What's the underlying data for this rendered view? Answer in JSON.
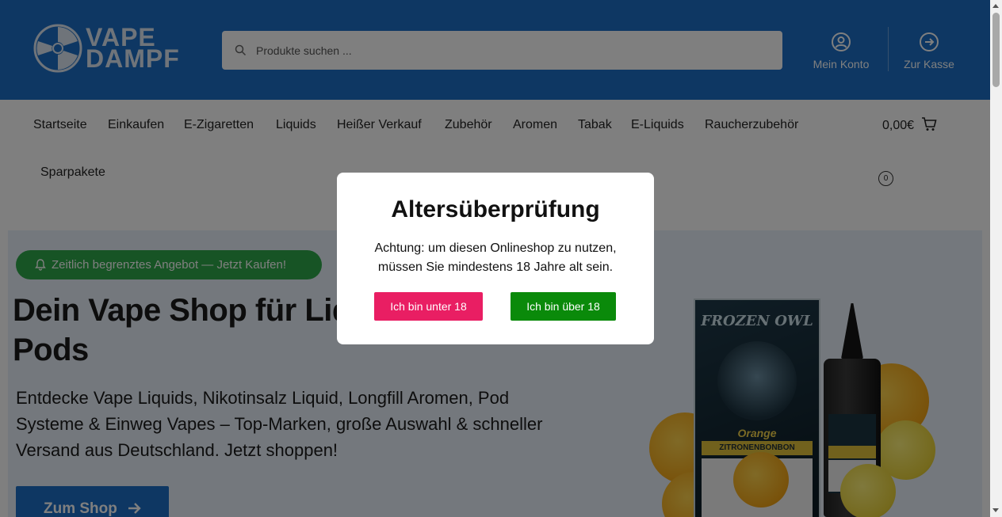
{
  "header": {
    "logo": {
      "line1": "VAPE",
      "line2": "DAMPF"
    },
    "search": {
      "placeholder": "Produkte suchen ..."
    },
    "account_label": "Mein Konto",
    "checkout_label": "Zur Kasse",
    "brand_color": "#1c6fc6"
  },
  "nav": {
    "items": [
      "Startseite",
      "Einkaufen",
      "E-Zigaretten",
      "Liquids",
      "Heißer Verkauf",
      "Zubehör",
      "Aromen",
      "Tabak",
      "E-Liquids",
      "Raucherzubehör",
      "Sparpakete"
    ],
    "cart_total": "0,00€",
    "cart_count": "0"
  },
  "hero": {
    "promo_label": "Zeitlich begrenztes Angebot — Jetzt Kaufen!",
    "title": "Dein Vape Shop für Liquids, E-Zigaretten & Pods",
    "text": "Entdecke Vape Liquids, Nikotinsalz Liquid, Longfill Aromen, Pod Systeme & Einweg Vapes – Top-Marken, große Auswahl & schneller Versand aus Deutschland. Jetzt shoppen!",
    "button_label": "Zum Shop",
    "product": {
      "brand": "FROZEN OWL",
      "flavor": "Orange",
      "subline": "ZITRONENBONBON"
    }
  },
  "age_modal": {
    "title": "Altersüberprüfung",
    "message": "Achtung: um diesen Onlineshop zu nutzen, müssen Sie mindestens 18 Jahre alt sein.",
    "under_label": "Ich bin unter 18",
    "over_label": "Ich bin über 18",
    "under_color": "#e91e63",
    "over_color": "#0a8a0a"
  }
}
